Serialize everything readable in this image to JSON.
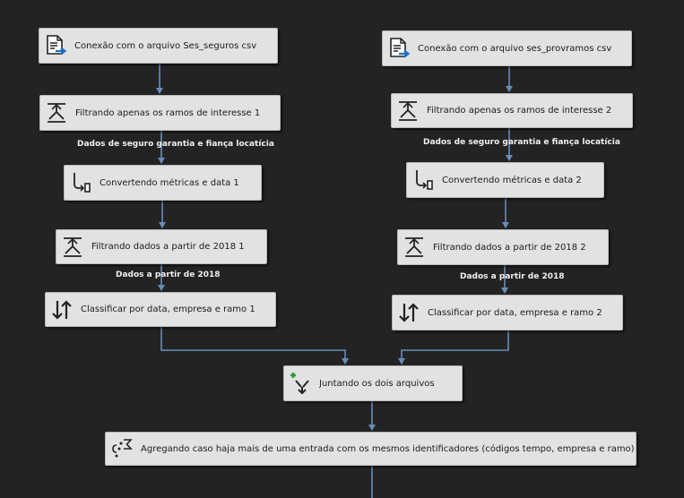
{
  "nodes": {
    "conn1": {
      "label": "Conexão com o arquivo Ses_seguros csv",
      "icon": "flat-file-source-icon"
    },
    "filter1": {
      "label": "Filtrando apenas os ramos de interesse 1",
      "icon": "conditional-split-icon"
    },
    "conv1": {
      "label": "Convertendo métricas e data 1",
      "icon": "data-conversion-icon"
    },
    "date1": {
      "label": "Filtrando dados a partir de 2018 1",
      "icon": "conditional-split-icon"
    },
    "sort1": {
      "label": "Classificar por data, empresa e ramo 1",
      "icon": "sort-icon"
    },
    "conn2": {
      "label": "Conexão com o arquivo ses_provramos csv",
      "icon": "flat-file-source-icon"
    },
    "filter2": {
      "label": "Filtrando apenas os ramos de interesse 2",
      "icon": "conditional-split-icon"
    },
    "conv2": {
      "label": "Convertendo métricas e data 2",
      "icon": "data-conversion-icon"
    },
    "date2": {
      "label": "Filtrando dados a partir de 2018 2",
      "icon": "conditional-split-icon"
    },
    "sort2": {
      "label": "Classificar por data, empresa e ramo 2",
      "icon": "sort-icon"
    },
    "merge": {
      "label": "Juntando os dois arquivos",
      "icon": "merge-join-icon"
    },
    "agg": {
      "label": "Agregando caso haja mais de uma entrada com os mesmos identificadores (códigos tempo, empresa e ramo)",
      "icon": "aggregate-icon"
    }
  },
  "path_labels": {
    "seguro1": "Dados de seguro garantia e fiança locatícia",
    "seguro2": "Dados de seguro garantia e fiança locatícia",
    "from2018_1": "Dados a partir de 2018",
    "from2018_2": "Dados a partir de 2018"
  },
  "colors": {
    "background": "#232323",
    "node_fill": "#e2e2e2",
    "connector": "#6b8cb8",
    "label_text": "#f0f0f0"
  }
}
